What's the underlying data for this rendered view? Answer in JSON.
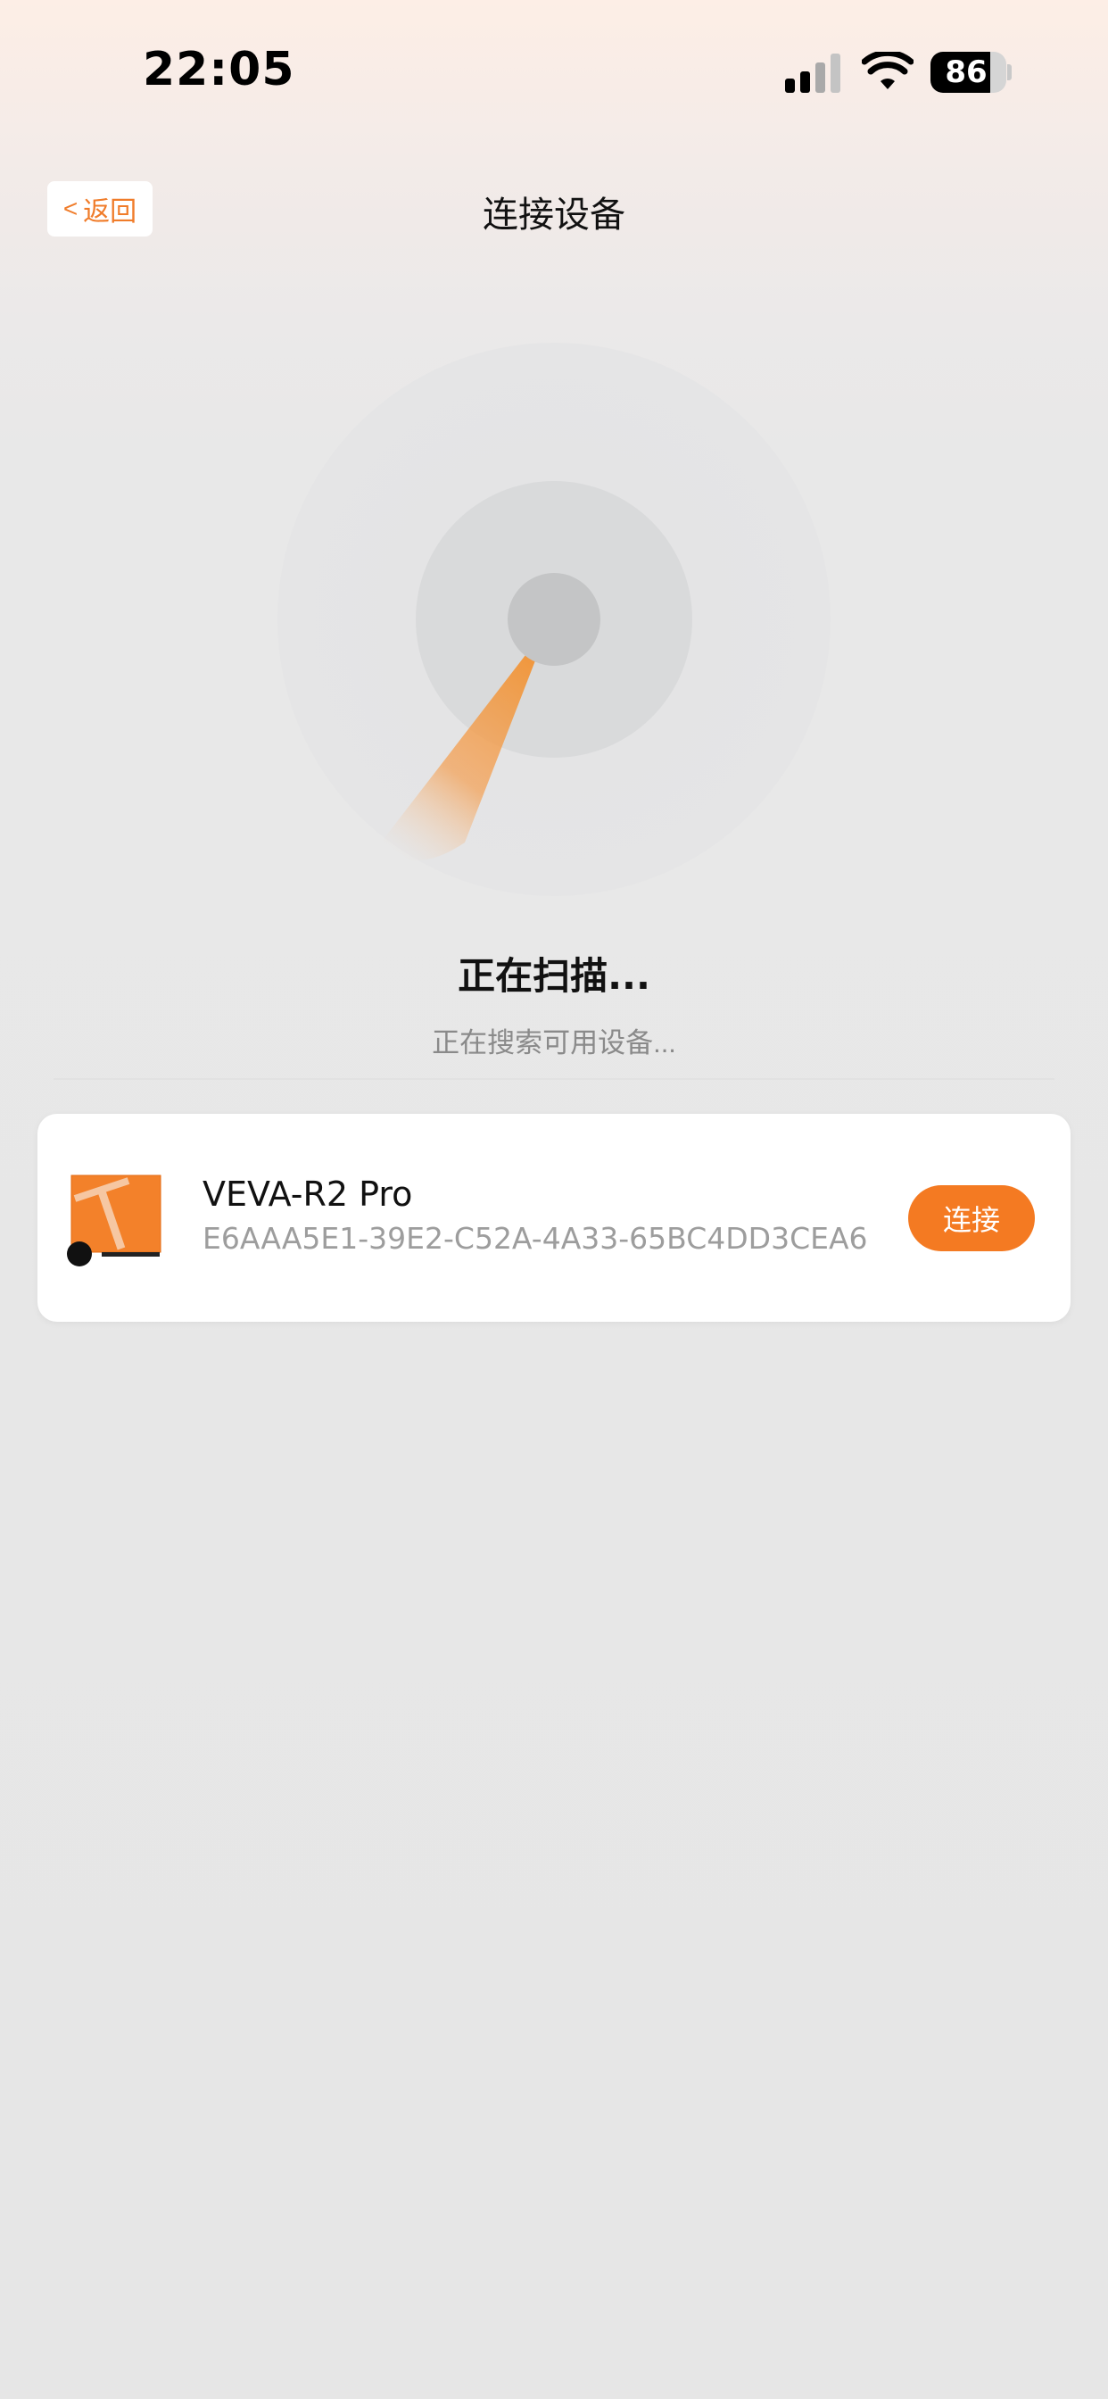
{
  "status_bar": {
    "time": "22:05",
    "battery_level": "86",
    "signal_icon": "cellular-signal-icon",
    "wifi_icon": "wifi-icon"
  },
  "header": {
    "back_chevron": "<",
    "back_label": "返回",
    "title": "连接设备"
  },
  "scan": {
    "title": "正在扫描...",
    "subtitle": "正在搜索可用设备..."
  },
  "devices": [
    {
      "name": "VEVA-R2 Pro",
      "id": "E6AAA5E1-39E2-C52A-4A33-65BC4DD3CEA6",
      "connect_label": "连接",
      "icon": "robot-device-icon"
    }
  ],
  "colors": {
    "accent": "#f47a22",
    "back_text": "#f07c2a",
    "background": "#e6e6e6",
    "card": "#ffffff"
  }
}
